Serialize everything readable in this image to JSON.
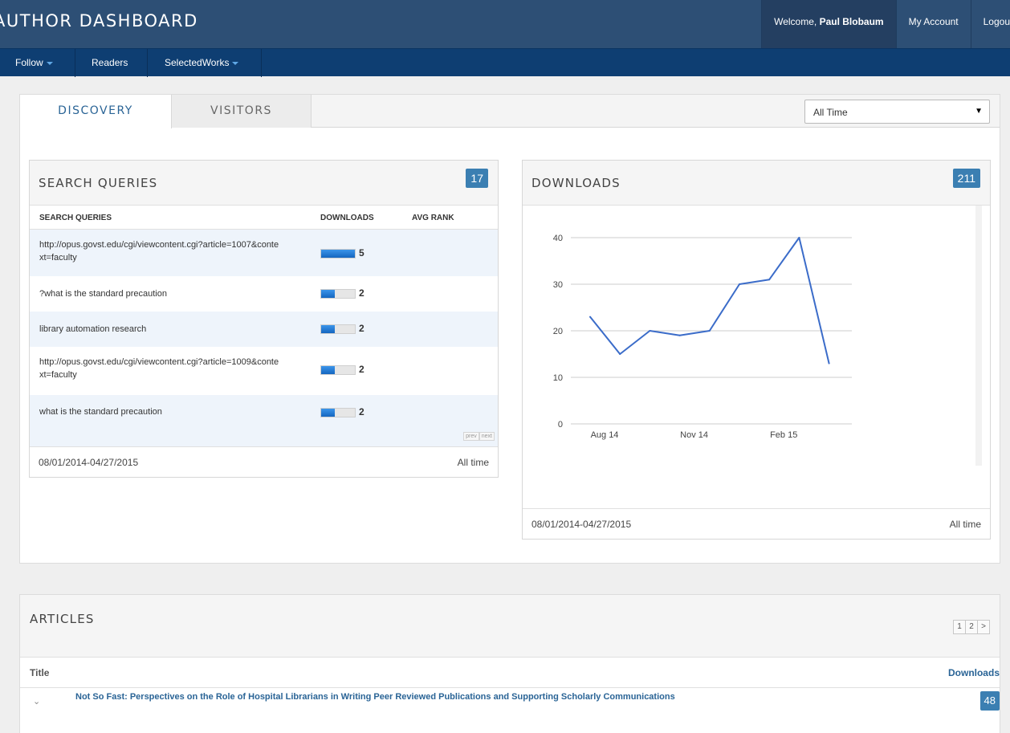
{
  "header": {
    "title": "AUTHOR DASHBOARD",
    "welcome_prefix": "Welcome, ",
    "user_name": "Paul Blobaum",
    "my_account": "My Account",
    "logout": "Logou"
  },
  "nav": {
    "follow": "Follow",
    "readers": "Readers",
    "selectedworks": "SelectedWorks"
  },
  "tabs": {
    "discovery": "DISCOVERY",
    "visitors": "VISITORS",
    "range_value": "All Time"
  },
  "search_queries": {
    "title": "SEARCH QUERIES",
    "count": "17",
    "col_query": "SEARCH QUERIES",
    "col_downloads": "DOWNLOADS",
    "col_avg_rank": "AVG RANK",
    "rows": [
      {
        "query": "http://opus.govst.edu/cgi/viewcontent.cgi?article=1007&context=faculty",
        "downloads": 5,
        "fill": 1.0
      },
      {
        "query": "?what is the standard precaution",
        "downloads": 2,
        "fill": 0.4
      },
      {
        "query": "library automation research",
        "downloads": 2,
        "fill": 0.4
      },
      {
        "query": "http://opus.govst.edu/cgi/viewcontent.cgi?article=1009&context=faculty",
        "downloads": 2,
        "fill": 0.4
      },
      {
        "query": "what is the standard precaution",
        "downloads": 2,
        "fill": 0.4
      }
    ],
    "prev": "prev",
    "next": "next",
    "date_range": "08/01/2014-04/27/2015",
    "period": "All time"
  },
  "downloads": {
    "title": "DOWNLOADS",
    "count": "211",
    "date_range": "08/01/2014-04/27/2015",
    "period": "All time"
  },
  "chart_data": {
    "type": "line",
    "x": [
      "Aug 14",
      "Sep 14",
      "Oct 14",
      "Nov 14",
      "Dec 14",
      "Jan 15",
      "Feb 15",
      "Mar 15",
      "Apr 15"
    ],
    "values": [
      23,
      15,
      20,
      19,
      20,
      30,
      31,
      40,
      13
    ],
    "x_tick_labels": [
      "Aug 14",
      "Nov 14",
      "Feb 15"
    ],
    "y_ticks": [
      0,
      10,
      20,
      30,
      40
    ],
    "ylim": [
      0,
      40
    ],
    "line_color": "#3b6cc9",
    "grid": true
  },
  "articles": {
    "title": "ARTICLES",
    "pages": [
      "1",
      "2",
      ">"
    ],
    "col_title": "Title",
    "col_downloads": "Downloads",
    "rows": [
      {
        "title": "Not So Fast: Perspectives on the Role of Hospital Librarians in Writing Peer Reviewed Publications and Supporting Scholarly Communications",
        "downloads": "48"
      }
    ]
  }
}
